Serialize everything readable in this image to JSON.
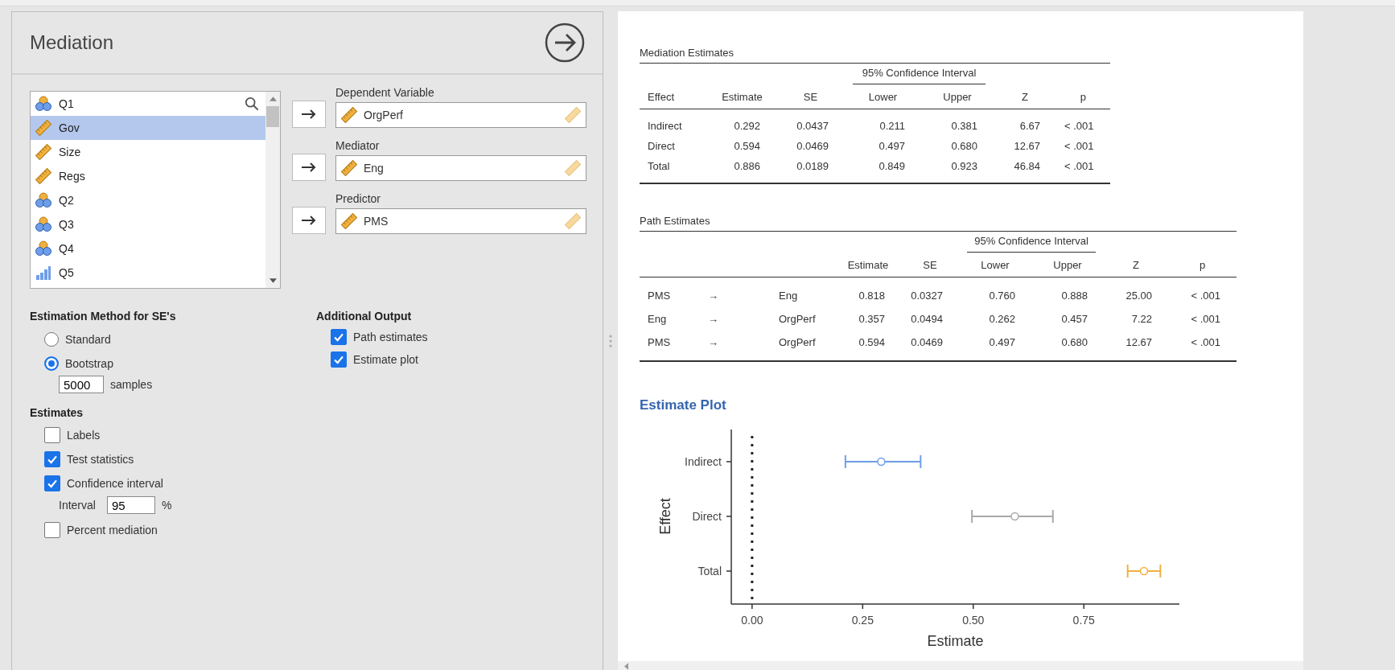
{
  "panel": {
    "title": "Mediation"
  },
  "variables": [
    {
      "name": "Q1",
      "kind": "nominal",
      "selected": false
    },
    {
      "name": "Gov",
      "kind": "continuous",
      "selected": true
    },
    {
      "name": "Size",
      "kind": "continuous",
      "selected": false
    },
    {
      "name": "Regs",
      "kind": "continuous",
      "selected": false
    },
    {
      "name": "Q2",
      "kind": "nominal",
      "selected": false
    },
    {
      "name": "Q3",
      "kind": "nominal",
      "selected": false
    },
    {
      "name": "Q4",
      "kind": "nominal",
      "selected": false
    },
    {
      "name": "Q5",
      "kind": "ordinal",
      "selected": false
    }
  ],
  "targets": [
    {
      "label": "Dependent Variable",
      "value": "OrgPerf"
    },
    {
      "label": "Mediator",
      "value": "Eng"
    },
    {
      "label": "Predictor",
      "value": "PMS"
    }
  ],
  "estimation_method": {
    "title": "Estimation Method for SE's",
    "options": [
      {
        "label": "Standard",
        "selected": false
      },
      {
        "label": "Bootstrap",
        "selected": true
      }
    ],
    "samples": "5000",
    "samples_label": "samples"
  },
  "estimates": {
    "title": "Estimates",
    "options": [
      {
        "label": "Labels",
        "checked": false
      },
      {
        "label": "Test statistics",
        "checked": true
      },
      {
        "label": "Confidence interval",
        "checked": true
      },
      {
        "label": "Percent mediation",
        "checked": false
      }
    ],
    "interval_label": "Interval",
    "interval": "95",
    "interval_unit": "%"
  },
  "additional_output": {
    "title": "Additional Output",
    "options": [
      {
        "label": "Path estimates",
        "checked": true
      },
      {
        "label": "Estimate plot",
        "checked": true
      }
    ]
  },
  "mediation_table": {
    "title": "Mediation Estimates",
    "spanner": "95% Confidence Interval",
    "columns": [
      "Effect",
      "Estimate",
      "SE",
      "Lower",
      "Upper",
      "Z",
      "p"
    ],
    "rows": [
      [
        "Indirect",
        "0.292",
        "0.0437",
        "0.211",
        "0.381",
        "6.67",
        "< .001"
      ],
      [
        "Direct",
        "0.594",
        "0.0469",
        "0.497",
        "0.680",
        "12.67",
        "< .001"
      ],
      [
        "Total",
        "0.886",
        "0.0189",
        "0.849",
        "0.923",
        "46.84",
        "< .001"
      ]
    ]
  },
  "path_table": {
    "title": "Path Estimates",
    "spanner": "95% Confidence Interval",
    "columns": [
      "",
      "",
      "",
      "Estimate",
      "SE",
      "Lower",
      "Upper",
      "Z",
      "p"
    ],
    "rows": [
      [
        "PMS",
        "→",
        "Eng",
        "0.818",
        "0.0327",
        "0.760",
        "0.888",
        "25.00",
        "< .001"
      ],
      [
        "Eng",
        "→",
        "OrgPerf",
        "0.357",
        "0.0494",
        "0.262",
        "0.457",
        "7.22",
        "< .001"
      ],
      [
        "PMS",
        "→",
        "OrgPerf",
        "0.594",
        "0.0469",
        "0.497",
        "0.680",
        "12.67",
        "< .001"
      ]
    ]
  },
  "estimate_plot": {
    "title": "Estimate Plot",
    "chart_data": {
      "type": "scatter",
      "orientation": "horizontal",
      "xlabel": "Estimate",
      "ylabel": "Effect",
      "categories": [
        "Indirect",
        "Direct",
        "Total"
      ],
      "xticks": [
        {
          "value": 0,
          "label": "0.00"
        },
        {
          "value": 0.25,
          "label": "0.25"
        },
        {
          "value": 0.5,
          "label": "0.50"
        },
        {
          "value": 0.75,
          "label": "0.75"
        }
      ],
      "xlim": [
        -0.047,
        0.966
      ],
      "series": [
        {
          "colors": [
            "#6f9ee8",
            "#a9a9a9",
            "#f0b040"
          ],
          "values": [
            0.292,
            0.594,
            0.886
          ],
          "errors": [
            [
              0.211,
              0.381
            ],
            [
              0.497,
              0.68
            ],
            [
              0.849,
              0.923
            ]
          ]
        }
      ]
    }
  }
}
